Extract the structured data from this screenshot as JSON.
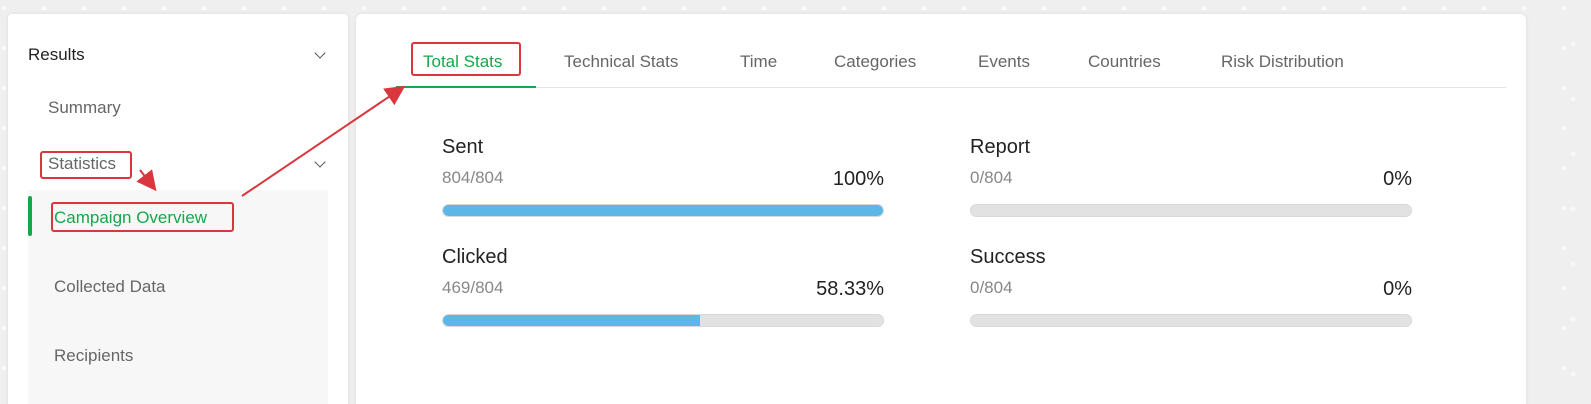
{
  "sidebar": {
    "results_label": "Results",
    "summary_label": "Summary",
    "statistics_label": "Statistics",
    "items": [
      {
        "label": "Campaign Overview",
        "active": true
      },
      {
        "label": "Collected Data",
        "active": false
      },
      {
        "label": "Recipients",
        "active": false
      }
    ]
  },
  "tabs": [
    {
      "label": "Total Stats",
      "active": true
    },
    {
      "label": "Technical Stats",
      "active": false
    },
    {
      "label": "Time",
      "active": false
    },
    {
      "label": "Categories",
      "active": false
    },
    {
      "label": "Events",
      "active": false
    },
    {
      "label": "Countries",
      "active": false
    },
    {
      "label": "Risk Distribution",
      "active": false
    }
  ],
  "stats": [
    {
      "label": "Sent",
      "count": "804/804",
      "percent": "100%",
      "progress": 1.0
    },
    {
      "label": "Report",
      "count": "0/804",
      "percent": "0%",
      "progress": 0.0
    },
    {
      "label": "Clicked",
      "count": "469/804",
      "percent": "58.33%",
      "progress": 0.5833
    },
    {
      "label": "Success",
      "count": "0/804",
      "percent": "0%",
      "progress": 0.0
    }
  ],
  "colors": {
    "accent": "#14a84a",
    "progress": "#5bb7e6",
    "annotation": "#d9363e"
  }
}
